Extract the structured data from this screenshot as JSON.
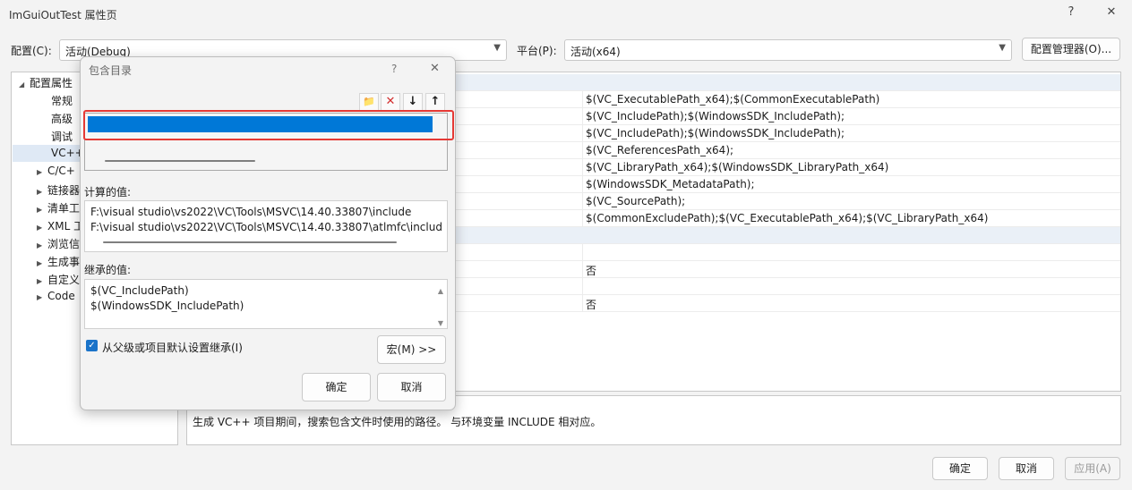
{
  "window": {
    "title": "ImGuiOutTest 属性页",
    "help": "?",
    "close": "✕"
  },
  "header": {
    "config_label": "配置(C):",
    "config_value": "活动(Debug)",
    "platform_label": "平台(P):",
    "platform_value": "活动(x64)",
    "config_manager": "配置管理器(O)..."
  },
  "tree": {
    "root": "配置属性",
    "items": [
      "常规",
      "高级",
      "调试",
      "VC++",
      "C/C+",
      "链接器",
      "清单工",
      "XML 工",
      "浏览信",
      "生成事",
      "自定义",
      "Code"
    ]
  },
  "grid": {
    "values": [
      "",
      "$(VC_ExecutablePath_x64);$(CommonExecutablePath)",
      "$(VC_IncludePath);$(WindowsSDK_IncludePath);",
      "$(VC_IncludePath);$(WindowsSDK_IncludePath);",
      "$(VC_ReferencesPath_x64);",
      "$(VC_LibraryPath_x64);$(WindowsSDK_LibraryPath_x64)",
      "$(WindowsSDK_MetadataPath);",
      "$(VC_SourcePath);",
      "$(CommonExcludePath);$(VC_ExecutablePath_x64);$(VC_LibraryPath_x64)",
      "",
      "",
      "否",
      "",
      "否"
    ]
  },
  "description": "生成 VC++ 项目期间，搜索包含文件时使用的路径。 与环境变量 INCLUDE 相对应。",
  "footer": {
    "ok": "确定",
    "cancel": "取消",
    "apply": "应用(A)"
  },
  "dialog": {
    "title": "包含目录",
    "help": "?",
    "close": "✕",
    "toolbar": {
      "new_folder": "📁",
      "delete": "✕",
      "move_down": "↓",
      "move_up": "↑"
    },
    "computed_label": "计算的值:",
    "computed_lines": [
      "F:\\visual studio\\vs2022\\VC\\Tools\\MSVC\\14.40.33807\\include",
      "F:\\visual studio\\vs2022\\VC\\Tools\\MSVC\\14.40.33807\\atlmfc\\includ"
    ],
    "inherited_label": "继承的值:",
    "inherited_lines": [
      "$(VC_IncludePath)",
      "$(WindowsSDK_IncludePath)"
    ],
    "inherit_checkbox": "从父级或项目默认设置继承(I)",
    "inherit_checked": true,
    "macros": "宏(M) >>",
    "ok": "确定",
    "cancel": "取消"
  },
  "colors": {
    "selection": "#0078d7",
    "highlight_box": "#e53935",
    "checkbox": "#1a73c9"
  }
}
